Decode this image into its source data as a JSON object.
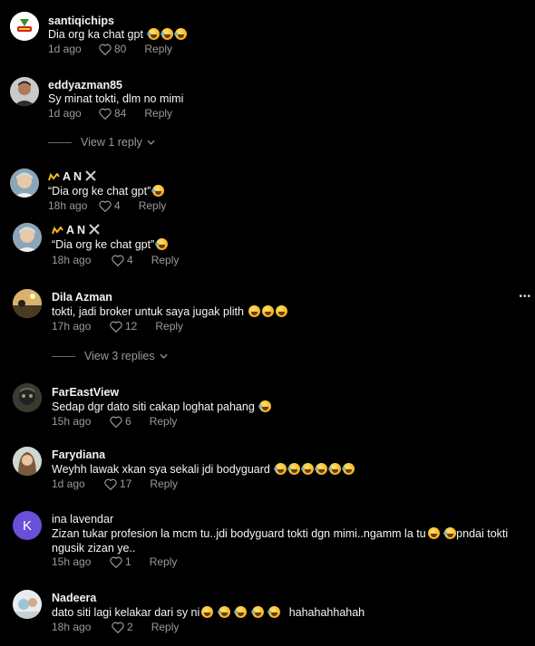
{
  "comments": [
    {
      "user": "santiqichips",
      "text": "Dia org ka chat gpt",
      "time": "1d ago",
      "likes": "80",
      "reply": "Reply",
      "emoji": [
        "laugh",
        "laugh",
        "laugh"
      ]
    },
    {
      "user": "eddyazman85",
      "text": "Sy minat tokti, dlm no mimi",
      "time": "1d ago",
      "likes": "84",
      "reply": "Reply",
      "view_replies": "View 1 reply"
    },
    {
      "user": "A N",
      "text": "“Dia org ke chat gpt”",
      "time": "18h ago",
      "likes": "4",
      "reply": "Reply",
      "emoji": [
        "laugh"
      ]
    },
    {
      "user": "A N",
      "text": "“Dia org ke chat gpt”",
      "time": "18h ago",
      "likes": "4",
      "reply": "Reply",
      "emoji": [
        "laugh"
      ]
    },
    {
      "user": "Dila Azman",
      "text": "tokti, jadi broker untuk saya jugak plith",
      "time": "17h ago",
      "likes": "12",
      "reply": "Reply",
      "emoji": [
        "relieved",
        "grin",
        "woozy"
      ],
      "view_replies": "View 3 replies"
    },
    {
      "user": "FarEastView",
      "text": "Sedap dgr dato siti cakap loghat pahang",
      "time": "15h ago",
      "likes": "6",
      "reply": "Reply",
      "emoji": [
        "laugh"
      ]
    },
    {
      "user": "Farydiana",
      "text": "Weyhh lawak xkan sya sekali jdi bodyguard",
      "time": "1d ago",
      "likes": "17",
      "reply": "Reply",
      "emoji": [
        "sob",
        "sob",
        "laugh",
        "laugh",
        "laugh",
        "laugh"
      ]
    },
    {
      "user": "ina lavendar",
      "avatar_letter": "K",
      "text_line1": "Zizan tukar profesion la mcm tu..jdi bodyguard tokti dgn mimi..ngamm la tu",
      "text_line1_after": "pndai tokti",
      "text_line2": "ngusik zizan ye..",
      "time": "15h ago",
      "likes": "1",
      "reply": "Reply"
    },
    {
      "user": "Nadeera",
      "text": "dato siti lagi kelakar dari sy ni",
      "text_after": "hahahahhahah",
      "time": "18h ago",
      "likes": "2",
      "reply": "Reply",
      "emoji": [
        "love",
        "sob",
        "laugh",
        "laugh",
        "laugh"
      ]
    }
  ],
  "icons": {
    "like": "heart-outline-icon",
    "chevron": "chevron-down-icon",
    "more": "more-dots-icon"
  },
  "colors": {
    "background": "#000000",
    "muted": "#9a9a9a",
    "avatar_purple": "#6a4fd8"
  }
}
